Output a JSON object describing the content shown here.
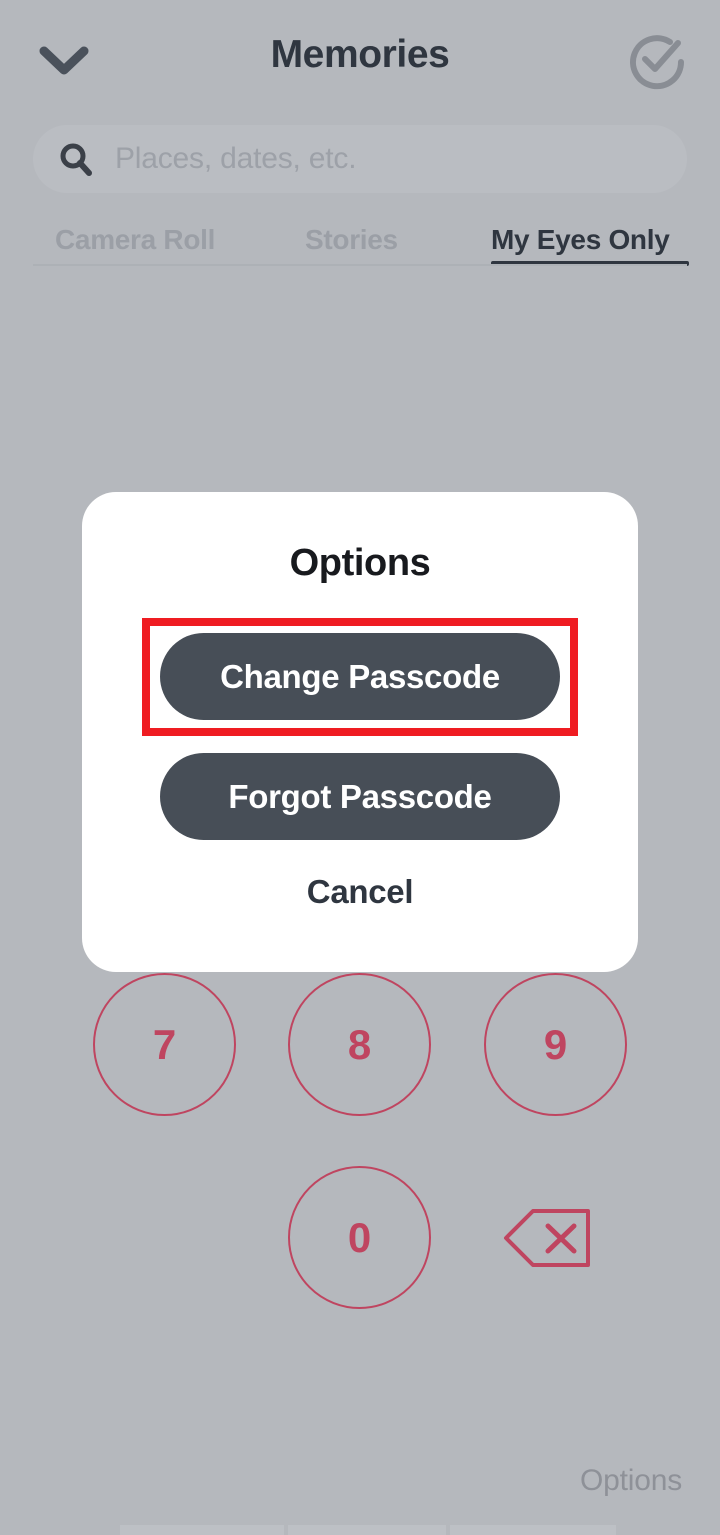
{
  "header": {
    "title": "Memories",
    "back_icon": "chevron-down-icon",
    "select_icon": "check-circle-icon"
  },
  "search": {
    "icon": "search-icon",
    "placeholder": "Places, dates, etc.",
    "value": ""
  },
  "tabs": [
    {
      "label": "Camera Roll",
      "active": false
    },
    {
      "label": "Stories",
      "active": false
    },
    {
      "label": "My Eyes Only",
      "active": true
    }
  ],
  "keypad": {
    "keys": [
      {
        "label": "7"
      },
      {
        "label": "8"
      },
      {
        "label": "9"
      },
      {
        "label": "0"
      }
    ],
    "backspace_icon": "backspace-delete-icon"
  },
  "footer": {
    "options_label": "Options"
  },
  "dialog": {
    "title": "Options",
    "change_passcode_label": "Change Passcode",
    "forgot_passcode_label": "Forgot Passcode",
    "cancel_label": "Cancel"
  },
  "annotation": {
    "target": "change-passcode-button",
    "color": "#ef1c22"
  },
  "colors": {
    "background": "#b5b8bd",
    "dark_button": "#474e57",
    "keypad_accent": "#bf4560",
    "dialog_surface": "#ffffff",
    "title_text": "#2f3640",
    "muted_text": "#9b9fa6",
    "highlight": "#ef1c22"
  }
}
